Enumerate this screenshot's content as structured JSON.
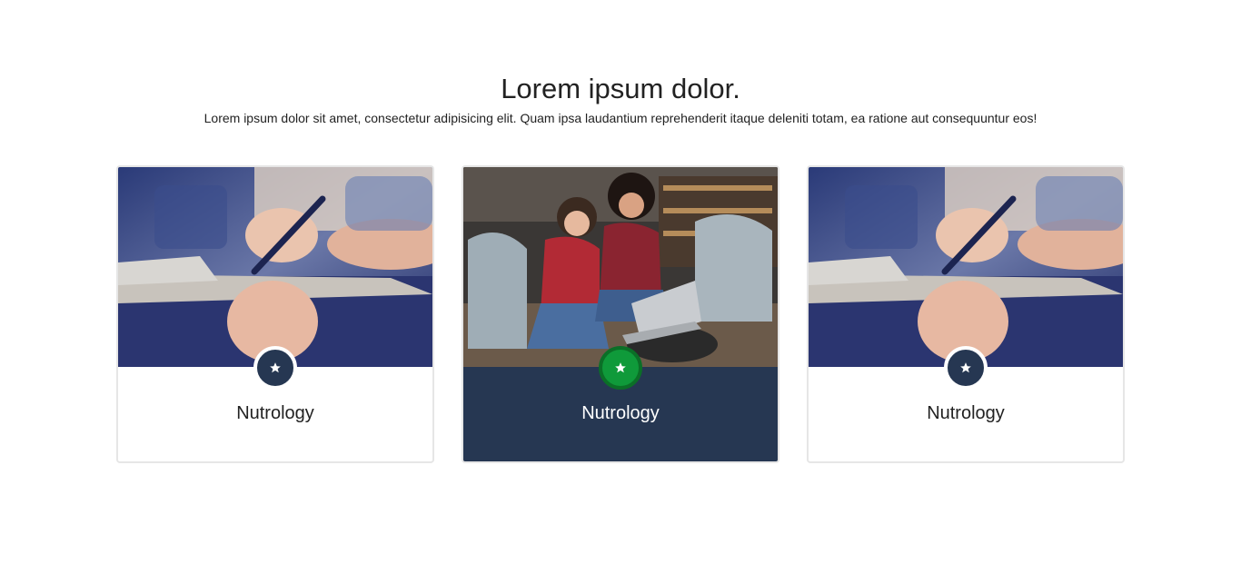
{
  "section": {
    "title": "Lorem ipsum dolor.",
    "subtitle": "Lorem ipsum dolor sit amet, consectetur adipisicing elit. Quam ipsa laudantium reprehenderit itaque deleniti totam, ea ratione aut consequuntur eos!"
  },
  "cards": [
    {
      "title": "Nutrology",
      "image": "writing-notes-photo",
      "icon": "star-icon",
      "active": false
    },
    {
      "title": "Nutrology",
      "image": "students-laptop-photo",
      "icon": "star-icon",
      "active": true
    },
    {
      "title": "Nutrology",
      "image": "writing-notes-photo",
      "icon": "star-icon",
      "active": false
    }
  ],
  "colors": {
    "accent_navy": "#263752",
    "active_badge_green": "#0f9a3a",
    "card_border": "#e6e6e6"
  }
}
